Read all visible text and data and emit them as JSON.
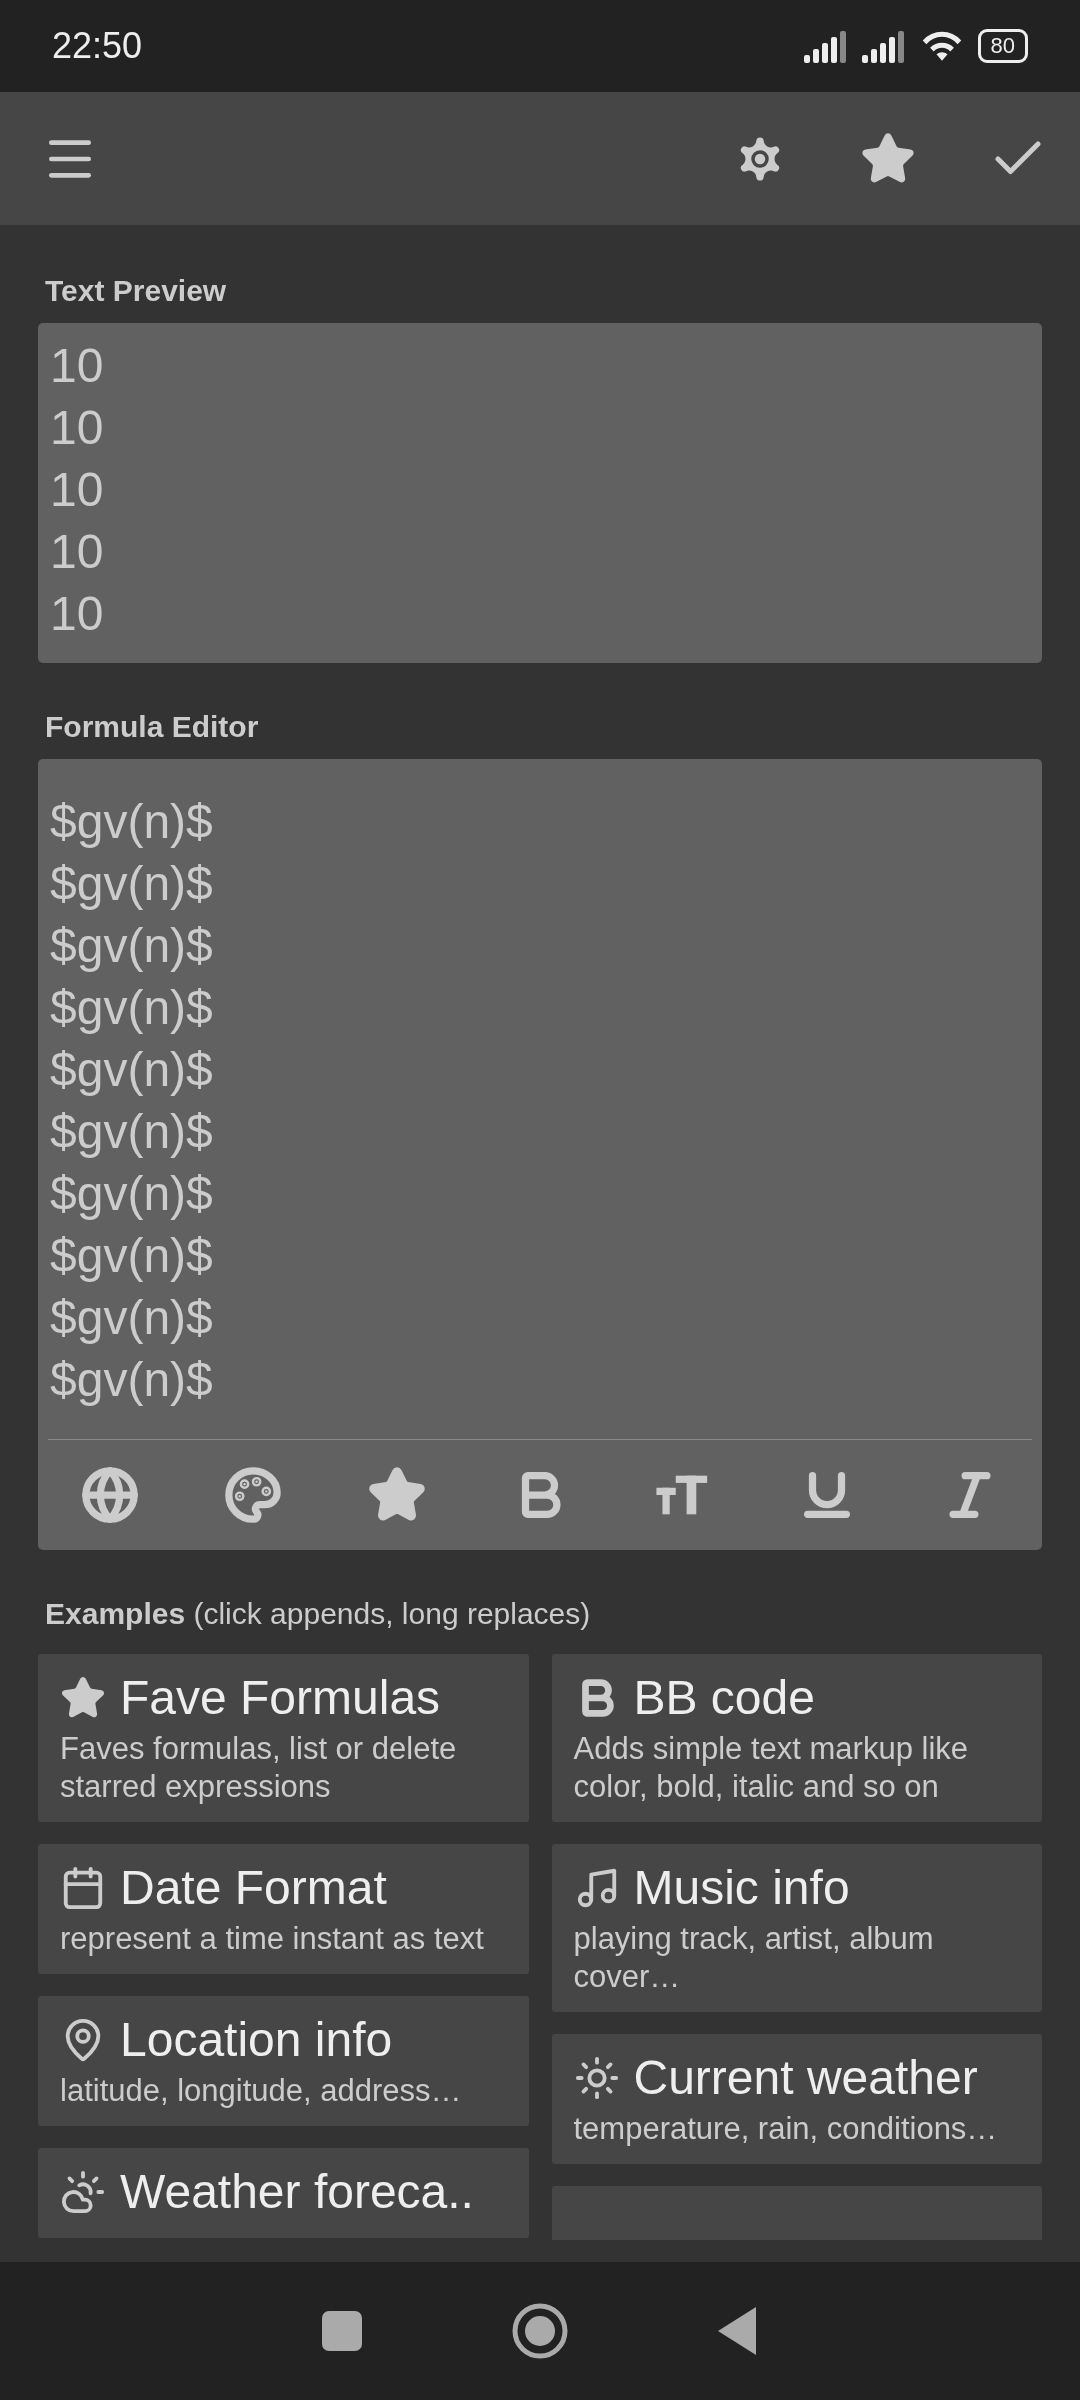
{
  "status_bar": {
    "time": "22:50",
    "battery": "80"
  },
  "preview": {
    "label": "Text Preview",
    "lines": [
      "10",
      "10",
      "10",
      "10",
      "10"
    ]
  },
  "editor": {
    "label": "Formula Editor",
    "lines": [
      "$gv(n)$",
      "$gv(n)$",
      "$gv(n)$",
      "$gv(n)$",
      "$gv(n)$",
      "$gv(n)$",
      "$gv(n)$",
      "$gv(n)$",
      "$gv(n)$",
      "$gv(n)$"
    ]
  },
  "examples": {
    "heading": "**Examples** (click appends, long replaces)",
    "columns": [
      [
        {
          "kind": "star",
          "title": "Fave Formulas",
          "description": "Faves formulas, list or delete starred expressions"
        },
        {
          "kind": "calendar",
          "title": "Date Format",
          "description": "represent a time instant as text"
        },
        {
          "kind": "pin",
          "title": "Location info",
          "description": "latitude, longitude, address…"
        },
        {
          "kind": "cloud-sun",
          "title": "Weather foreca.."
        }
      ],
      [
        {
          "kind": "bold",
          "title": "BB code",
          "description": "Adds simple text markup like color, bold, italic and so on"
        },
        {
          "kind": "music",
          "title": "Music info",
          "description": "playing track, artist, album cover…"
        },
        {
          "kind": "sun",
          "title": "Current weather",
          "description": "temperature, rain, conditions…"
        },
        {
          "kind": "blank"
        }
      ]
    ]
  }
}
